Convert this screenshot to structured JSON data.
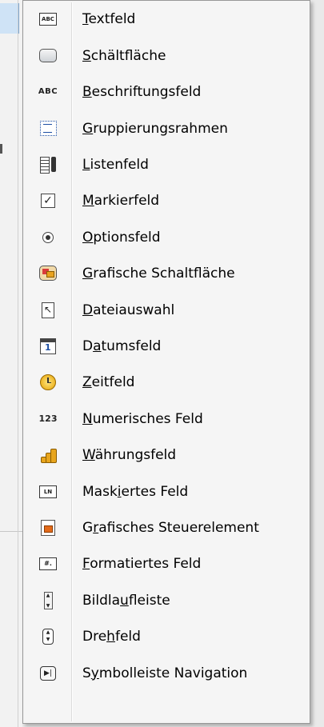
{
  "menu": {
    "items": [
      {
        "icon": "textfield-icon",
        "pre": "",
        "mn": "T",
        "post": "extfeld"
      },
      {
        "icon": "button-icon",
        "pre": "",
        "mn": "S",
        "post": "chältfläche"
      },
      {
        "icon": "label-field-icon",
        "icon_text": "ABC",
        "pre": "",
        "mn": "B",
        "post": "eschriftungsfeld"
      },
      {
        "icon": "group-box-icon",
        "pre": "",
        "mn": "G",
        "post": "ruppierungsrahmen"
      },
      {
        "icon": "list-box-icon",
        "pre": "",
        "mn": "L",
        "post": "istenfeld"
      },
      {
        "icon": "checkbox-icon",
        "pre": "",
        "mn": "M",
        "post": "arkierfeld"
      },
      {
        "icon": "option-button-icon",
        "pre": "",
        "mn": "O",
        "post": "ptionsfeld"
      },
      {
        "icon": "image-button-icon",
        "pre": "",
        "mn": "G",
        "post": "rafische Schaltfläche"
      },
      {
        "icon": "file-selection-icon",
        "pre": "",
        "mn": "D",
        "post": "ateiauswahl"
      },
      {
        "icon": "date-field-icon",
        "pre": "D",
        "mn": "a",
        "post": "tumsfeld"
      },
      {
        "icon": "time-field-icon",
        "pre": "",
        "mn": "Z",
        "post": "eitfeld"
      },
      {
        "icon": "numeric-field-icon",
        "icon_text": "123",
        "pre": "",
        "mn": "N",
        "post": "umerisches Feld"
      },
      {
        "icon": "currency-field-icon",
        "pre": "",
        "mn": "W",
        "post": "ährungsfeld"
      },
      {
        "icon": "masked-field-icon",
        "icon_text": "LN",
        "pre": "Mask",
        "mn": "i",
        "post": "ertes Feld"
      },
      {
        "icon": "image-control-icon",
        "pre": "G",
        "mn": "r",
        "post": "afisches Steuerelement"
      },
      {
        "icon": "formatted-field-icon",
        "icon_text": "#.",
        "pre": "",
        "mn": "F",
        "post": "ormatiertes Feld"
      },
      {
        "icon": "scrollbar-icon",
        "pre": "Bildla",
        "mn": "u",
        "post": "fleiste"
      },
      {
        "icon": "spin-button-icon",
        "pre": "Dre",
        "mn": "h",
        "post": "feld"
      },
      {
        "icon": "navigation-bar-icon",
        "pre": "S",
        "mn": "y",
        "post": "mbolleiste Navigation"
      }
    ]
  }
}
